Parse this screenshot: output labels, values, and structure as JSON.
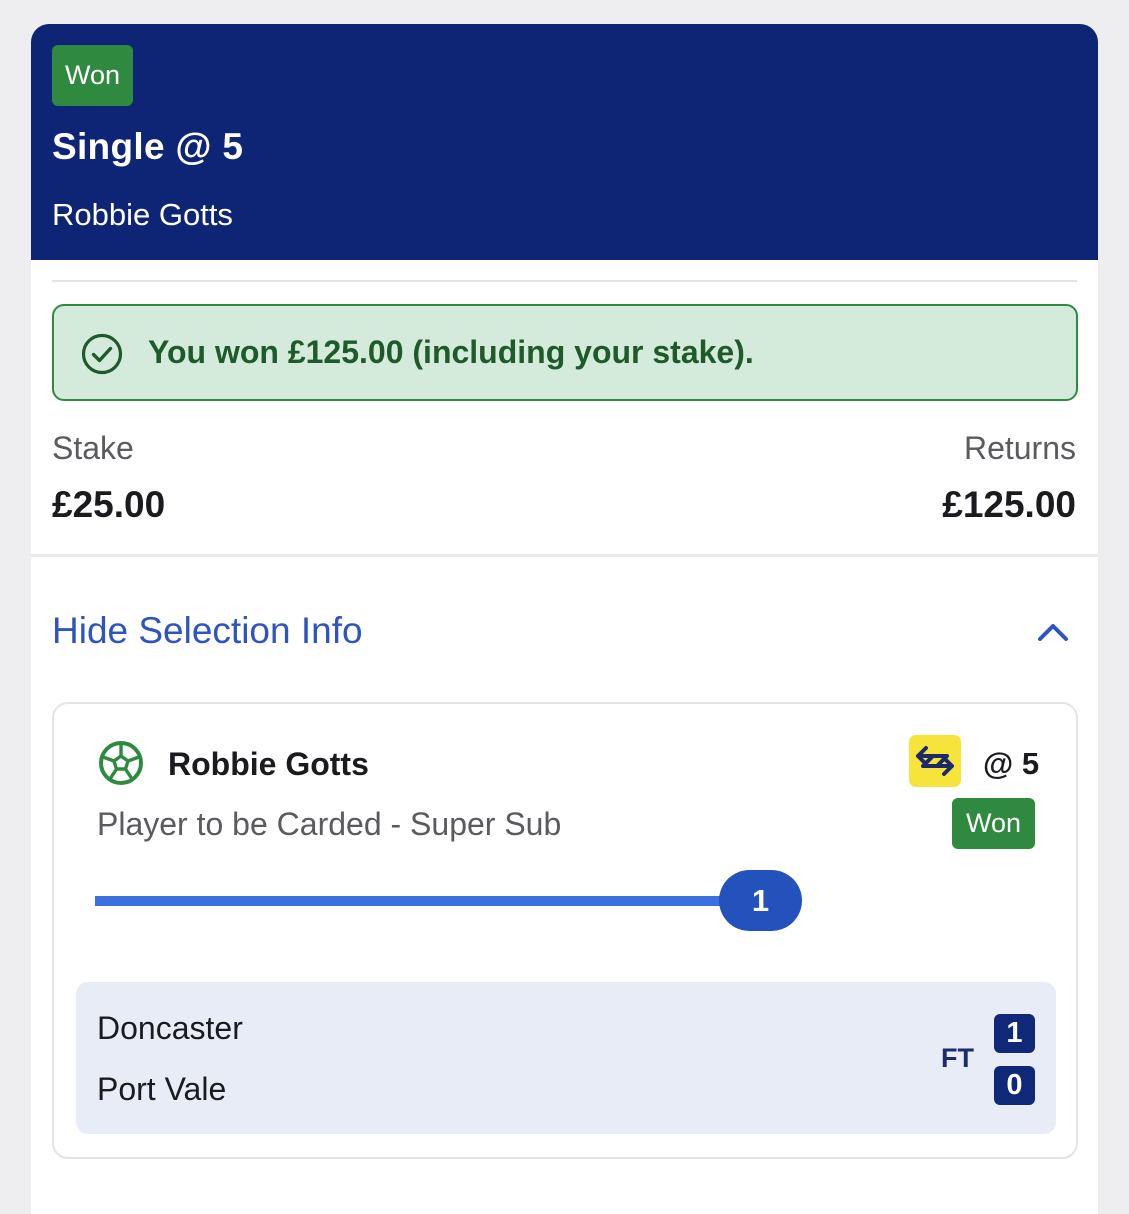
{
  "colors": {
    "header_bg": "#0e2576",
    "won_green": "#2f8a3f",
    "banner_bg": "#d4eadb",
    "link_blue": "#2e54bf",
    "progress_blue": "#3a70e0",
    "supersub_yellow": "#f7e43b"
  },
  "header": {
    "status_badge": "Won",
    "title": "Single @ 5",
    "subtitle": "Robbie Gotts"
  },
  "result_banner": {
    "icon": "check-circle-icon",
    "text": "You won £125.00 (including your stake)."
  },
  "summary": {
    "stake_label": "Stake",
    "stake_value": "£25.00",
    "returns_label": "Returns",
    "returns_value": "£125.00"
  },
  "selection_toggle": {
    "label": "Hide Selection Info",
    "icon": "chevron-up-icon"
  },
  "selection": {
    "sport_icon": "football-icon",
    "player": "Robbie Gotts",
    "boost_icon": "super-sub-swap-icon",
    "odds": "@ 5",
    "market": "Player to be Carded - Super Sub",
    "status_badge": "Won",
    "progress_value": "1",
    "progress_fraction": 1.0
  },
  "scoreboard": {
    "home_team": "Doncaster",
    "away_team": "Port Vale",
    "period": "FT",
    "home_score": "1",
    "away_score": "0"
  }
}
